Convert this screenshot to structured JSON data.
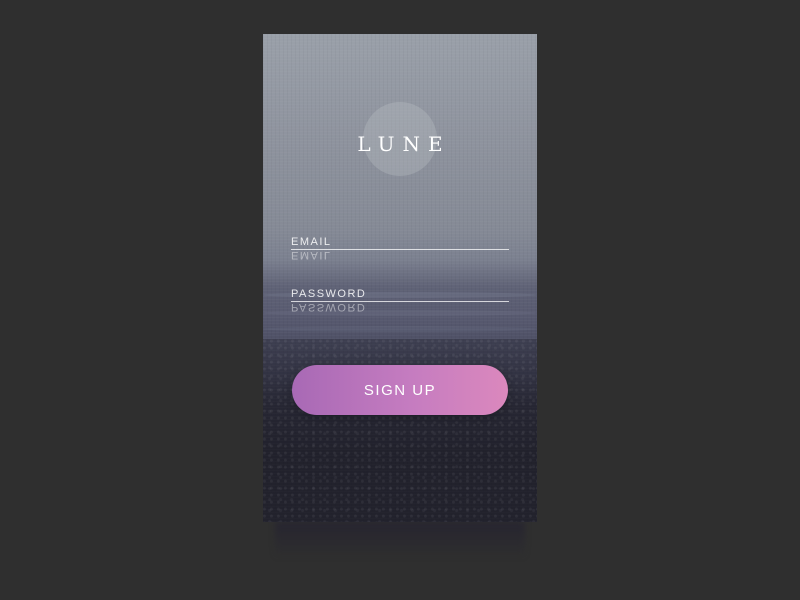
{
  "app": {
    "logo_text": "LUNE"
  },
  "form": {
    "email_label": "EMAIL",
    "email_value": "",
    "password_label": "PASSWORD",
    "password_value": "",
    "signup_label": "SIGN UP"
  },
  "colors": {
    "page_background": "#2f2f2f",
    "button_gradient_start": "#a869b5",
    "button_gradient_end": "#db88bd",
    "text": "#ffffff"
  },
  "icons": {
    "moon": "moon-circle-icon"
  }
}
